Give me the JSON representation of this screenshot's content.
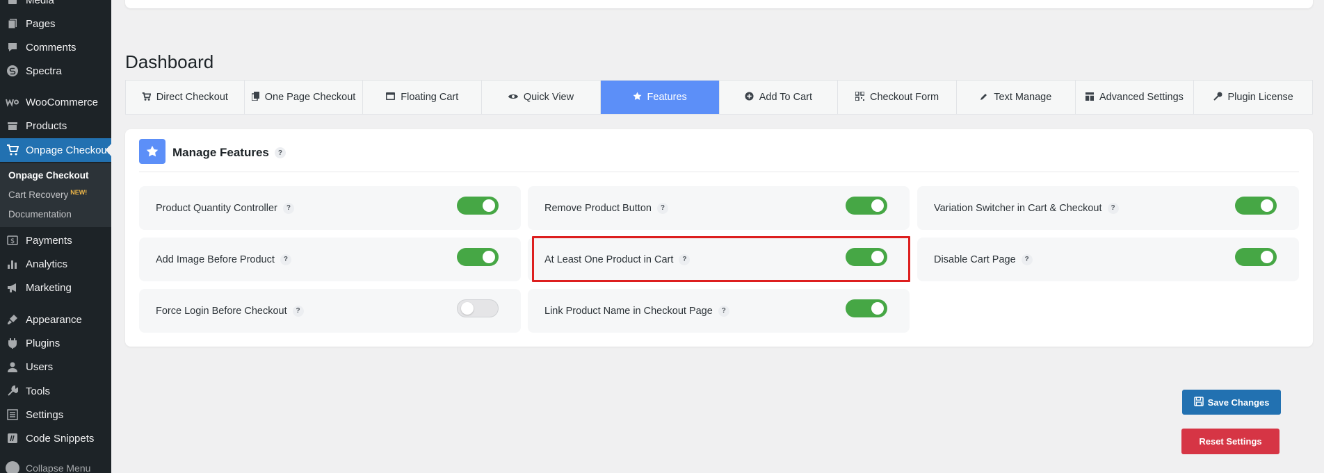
{
  "sidebar": {
    "items": [
      {
        "label": "Media",
        "icon": "media-icon"
      },
      {
        "label": "Pages",
        "icon": "pages-icon"
      },
      {
        "label": "Comments",
        "icon": "comments-icon"
      },
      {
        "label": "Spectra",
        "icon": "spectra-icon"
      },
      {
        "label": "WooCommerce",
        "icon": "woocommerce-icon"
      },
      {
        "label": "Products",
        "icon": "products-icon"
      },
      {
        "label": "Onpage Checkout",
        "icon": "cart-icon",
        "active": true
      },
      {
        "label": "Payments",
        "icon": "payments-icon"
      },
      {
        "label": "Analytics",
        "icon": "analytics-icon"
      },
      {
        "label": "Marketing",
        "icon": "marketing-icon"
      },
      {
        "label": "Appearance",
        "icon": "appearance-icon"
      },
      {
        "label": "Plugins",
        "icon": "plugins-icon"
      },
      {
        "label": "Users",
        "icon": "users-icon"
      },
      {
        "label": "Tools",
        "icon": "tools-icon"
      },
      {
        "label": "Settings",
        "icon": "settings-icon"
      },
      {
        "label": "Code Snippets",
        "icon": "code-snippets-icon"
      }
    ],
    "submenu": [
      {
        "label": "Onpage Checkout",
        "current": true
      },
      {
        "label": "Cart Recovery",
        "badge": "NEW!"
      },
      {
        "label": "Documentation"
      }
    ],
    "collapse_label": "Collapse Menu"
  },
  "page_title": "Dashboard",
  "tabs": [
    {
      "label": "Direct Checkout",
      "icon": "cart-icon"
    },
    {
      "label": "One Page Checkout",
      "icon": "copy-icon"
    },
    {
      "label": "Floating Cart",
      "icon": "window-icon"
    },
    {
      "label": "Quick View",
      "icon": "eye-icon"
    },
    {
      "label": "Features",
      "icon": "star-icon",
      "active": true
    },
    {
      "label": "Add To Cart",
      "icon": "plus-circle-icon"
    },
    {
      "label": "Checkout Form",
      "icon": "qr-icon"
    },
    {
      "label": "Text Manage",
      "icon": "pencil-icon"
    },
    {
      "label": "Advanced Settings",
      "icon": "grid-icon"
    },
    {
      "label": "Plugin License",
      "icon": "key-icon"
    }
  ],
  "panel": {
    "title": "Manage Features",
    "help": "?",
    "features": [
      {
        "label": "Product Quantity Controller",
        "enabled": true
      },
      {
        "label": "Remove Product Button",
        "enabled": true
      },
      {
        "label": "Variation Switcher in Cart & Checkout",
        "enabled": true
      },
      {
        "label": "Add Image Before Product",
        "enabled": true
      },
      {
        "label": "At Least One Product in Cart",
        "enabled": true,
        "highlighted": true
      },
      {
        "label": "Disable Cart Page",
        "enabled": true
      },
      {
        "label": "Force Login Before Checkout",
        "enabled": false
      },
      {
        "label": "Link Product Name in Checkout Page",
        "enabled": true
      }
    ]
  },
  "actions": {
    "save_label": "Save Changes",
    "reset_label": "Reset Settings"
  },
  "colors": {
    "accent": "#5c8ff8",
    "toggle_on": "#46a745",
    "save": "#2271b1",
    "reset": "#d63545",
    "highlight": "#dd1f1f"
  }
}
